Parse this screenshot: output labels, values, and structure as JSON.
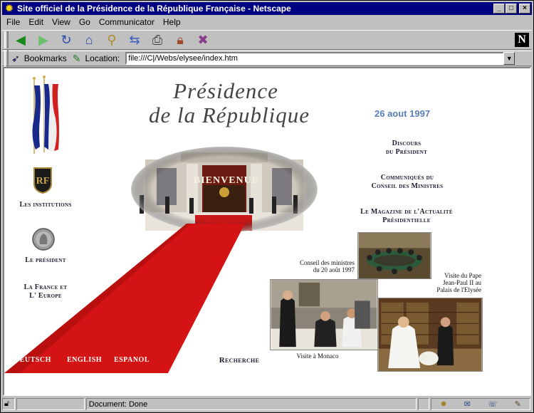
{
  "window": {
    "title": "Site officiel de la Présidence de la République Française - Netscape",
    "controls": {
      "minimize": "_",
      "maximize": "□",
      "close": "×"
    }
  },
  "menu": [
    "File",
    "Edit",
    "View",
    "Go",
    "Communicator",
    "Help"
  ],
  "toolbar": {
    "icons": [
      "back-icon",
      "forward-icon",
      "reload-icon",
      "home-icon",
      "search-icon",
      "guide-icon",
      "print-icon",
      "security-icon",
      "stop-icon"
    ],
    "logo": "N"
  },
  "location": {
    "bookmarks_label": "Bookmarks",
    "location_label": "Location:",
    "url": "file:///C|/Webs/elysee/index.htm"
  },
  "page": {
    "title_line1": "Présidence",
    "title_line2": "de la République",
    "date": "26 aout 1997",
    "banner": "BIENVENUE",
    "left_nav": {
      "institutions": "Les institutions",
      "president": "Le président",
      "france_europe_1": "La France et",
      "france_europe_2": "L' Europe"
    },
    "right_nav": {
      "discours_1": "Discours",
      "discours_2": "du Président",
      "communiques_1": "Communiqués du",
      "communiques_2": "Conseil des Ministres",
      "magazine_1": "Le Magazine de l'Actualité",
      "magazine_2": "Présidentielle"
    },
    "captions": {
      "conseil_1": "Conseil des ministres",
      "conseil_2": "du 20 août 1997",
      "pape_1": "Visite du Pape",
      "pape_2": "Jean-Paul II au",
      "pape_3": "Palais de l'Elysée",
      "monaco": "Visite à Monaco"
    },
    "languages": [
      "DEUTSCH",
      "ENGLISH",
      "ESPANOL"
    ],
    "search": "Recherche"
  },
  "status": {
    "text": "Document: Done"
  }
}
